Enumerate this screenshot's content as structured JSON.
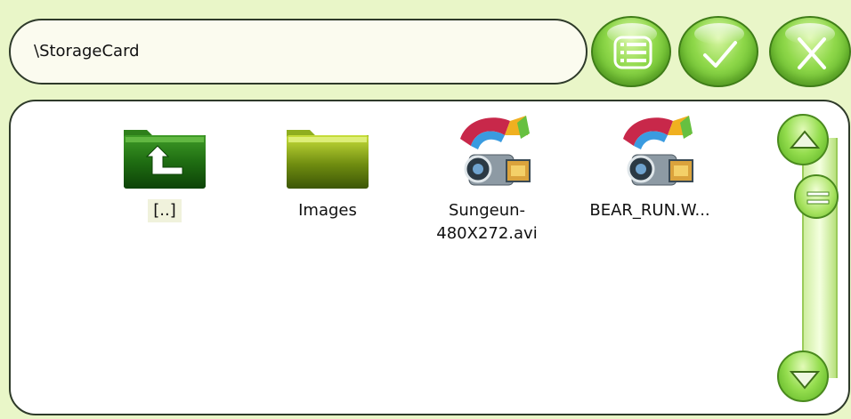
{
  "path_bar": {
    "path": "\\StorageCard"
  },
  "toolbar": {
    "view_list": {
      "icon": "list-icon"
    },
    "confirm": {
      "icon": "check-icon"
    },
    "close": {
      "icon": "close-icon"
    }
  },
  "files": [
    {
      "name": "[..]",
      "type": "parent-folder",
      "icon": "parent-folder-icon",
      "selected": true
    },
    {
      "name": "Images",
      "type": "folder",
      "icon": "folder-icon",
      "selected": false
    },
    {
      "name": "Sungeun-\n480X272.avi",
      "type": "video",
      "icon": "video-file-icon",
      "selected": false
    },
    {
      "name": "BEAR_RUN.W...",
      "type": "video",
      "icon": "video-file-icon",
      "selected": false
    }
  ],
  "scrollbar": {
    "up_icon": "arrow-up-icon",
    "down_icon": "arrow-down-icon",
    "thumb_icon": "grip-icon",
    "position": 0.1
  },
  "colors": {
    "background": "#e9f6c8",
    "button_green": "#8fd84a",
    "border": "#2e3a2a"
  }
}
